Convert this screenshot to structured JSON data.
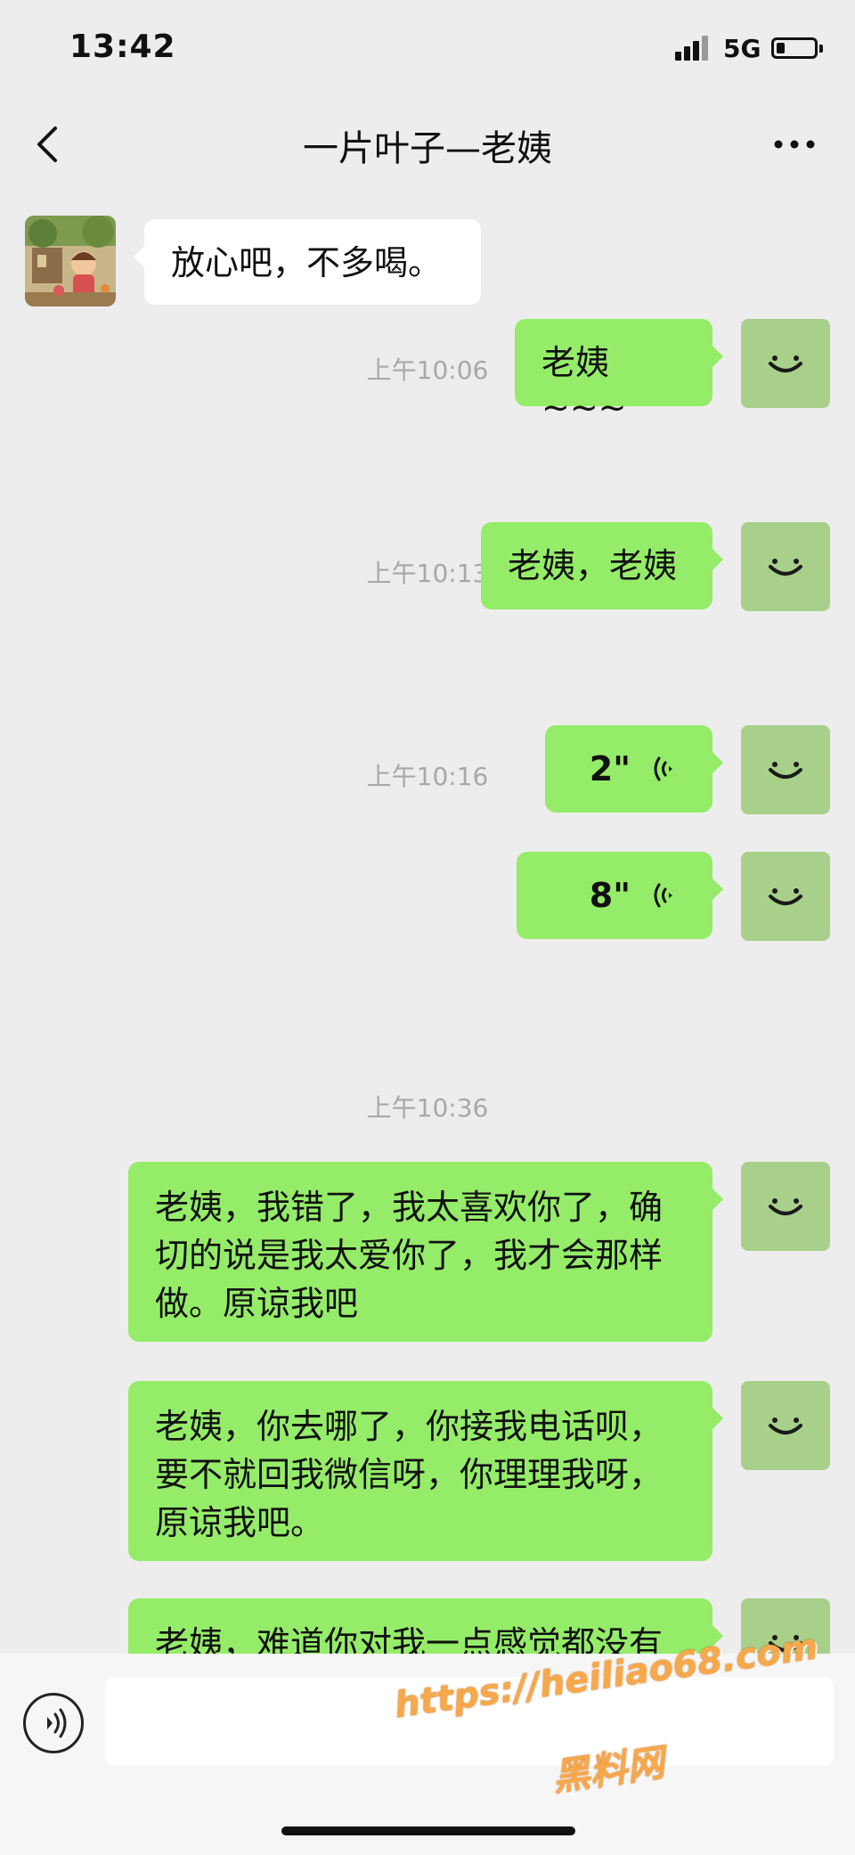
{
  "status_bar": {
    "time": "13:42",
    "network": "5G",
    "battery_level": 0.22
  },
  "header": {
    "title": "一片叶子—老姨"
  },
  "icons": {
    "back": "chevron-left-icon",
    "more": "more-dots-icon",
    "voice": "voice-toggle-icon",
    "avatar_out": "smiley-avatar-icon"
  },
  "colors": {
    "background": "#ededed",
    "outgoing_bubble": "#95ec69",
    "incoming_bubble": "#ffffff",
    "outgoing_avatar": "#a8d08a",
    "timestamp": "#a8a8a8",
    "watermark": "#f7a84a"
  },
  "messages": [
    {
      "type": "text",
      "dir": "in",
      "text": "放心吧，不多喝。"
    },
    {
      "type": "time",
      "text": "上午10:06"
    },
    {
      "type": "text",
      "dir": "out",
      "text": "老姨~~~"
    },
    {
      "type": "time",
      "text": "上午10:13"
    },
    {
      "type": "text",
      "dir": "out",
      "text": "老姨，老姨"
    },
    {
      "type": "time",
      "text": "上午10:16"
    },
    {
      "type": "voice",
      "dir": "out",
      "duration": "2\""
    },
    {
      "type": "voice",
      "dir": "out",
      "duration": "8\""
    },
    {
      "type": "time",
      "text": "上午10:36"
    },
    {
      "type": "text",
      "dir": "out",
      "lines": [
        "老姨，我错了，我太喜欢你了，确",
        "切的说是我太爱你了，我才会那样",
        "做。原谅我吧"
      ]
    },
    {
      "type": "text",
      "dir": "out",
      "lines": [
        "老姨，你去哪了，你接我电话呗，",
        "要不就回我微信呀，你理理我呀，",
        "原谅我吧。"
      ]
    },
    {
      "type": "text",
      "dir": "out",
      "lines": [
        "老姨，难道你对我一点感觉都没有"
      ]
    }
  ],
  "input": {
    "placeholder": ""
  },
  "watermark": {
    "url": "https://heiliao68.com",
    "name": "黑料网"
  }
}
